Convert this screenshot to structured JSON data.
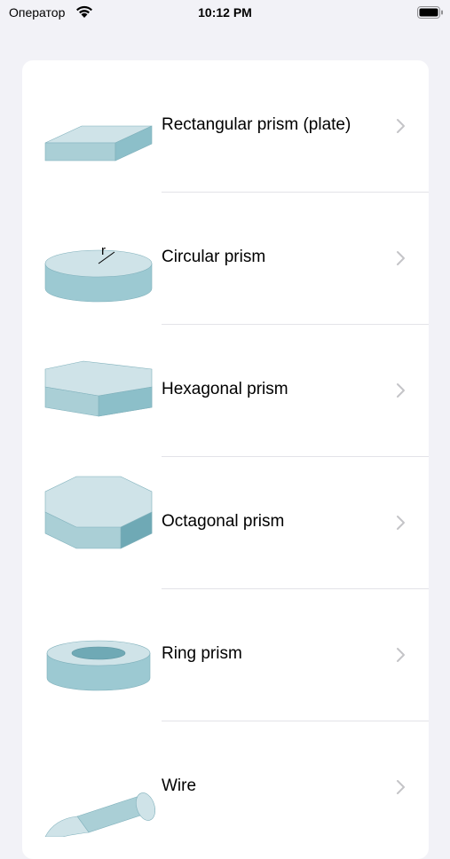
{
  "status_bar": {
    "carrier": "Оператор",
    "time": "10:12 PM",
    "wifi_icon": "wifi-icon",
    "battery_icon": "battery-icon"
  },
  "shapes": [
    {
      "label": "Rectangular prism (plate)",
      "icon": "rectangular-prism-icon"
    },
    {
      "label": "Circular prism",
      "icon": "circular-prism-icon",
      "annotation": "r"
    },
    {
      "label": "Hexagonal prism",
      "icon": "hexagonal-prism-icon"
    },
    {
      "label": "Octagonal prism",
      "icon": "octagonal-prism-icon"
    },
    {
      "label": "Ring prism",
      "icon": "ring-prism-icon"
    },
    {
      "label": "Wire",
      "icon": "wire-icon"
    }
  ],
  "colors": {
    "background": "#f2f2f7",
    "card": "#ffffff",
    "shape_light": "#cfe3e8",
    "shape_mid": "#aacfd6",
    "shape_dark": "#6fa9b5",
    "chevron": "#c4c4c7"
  }
}
